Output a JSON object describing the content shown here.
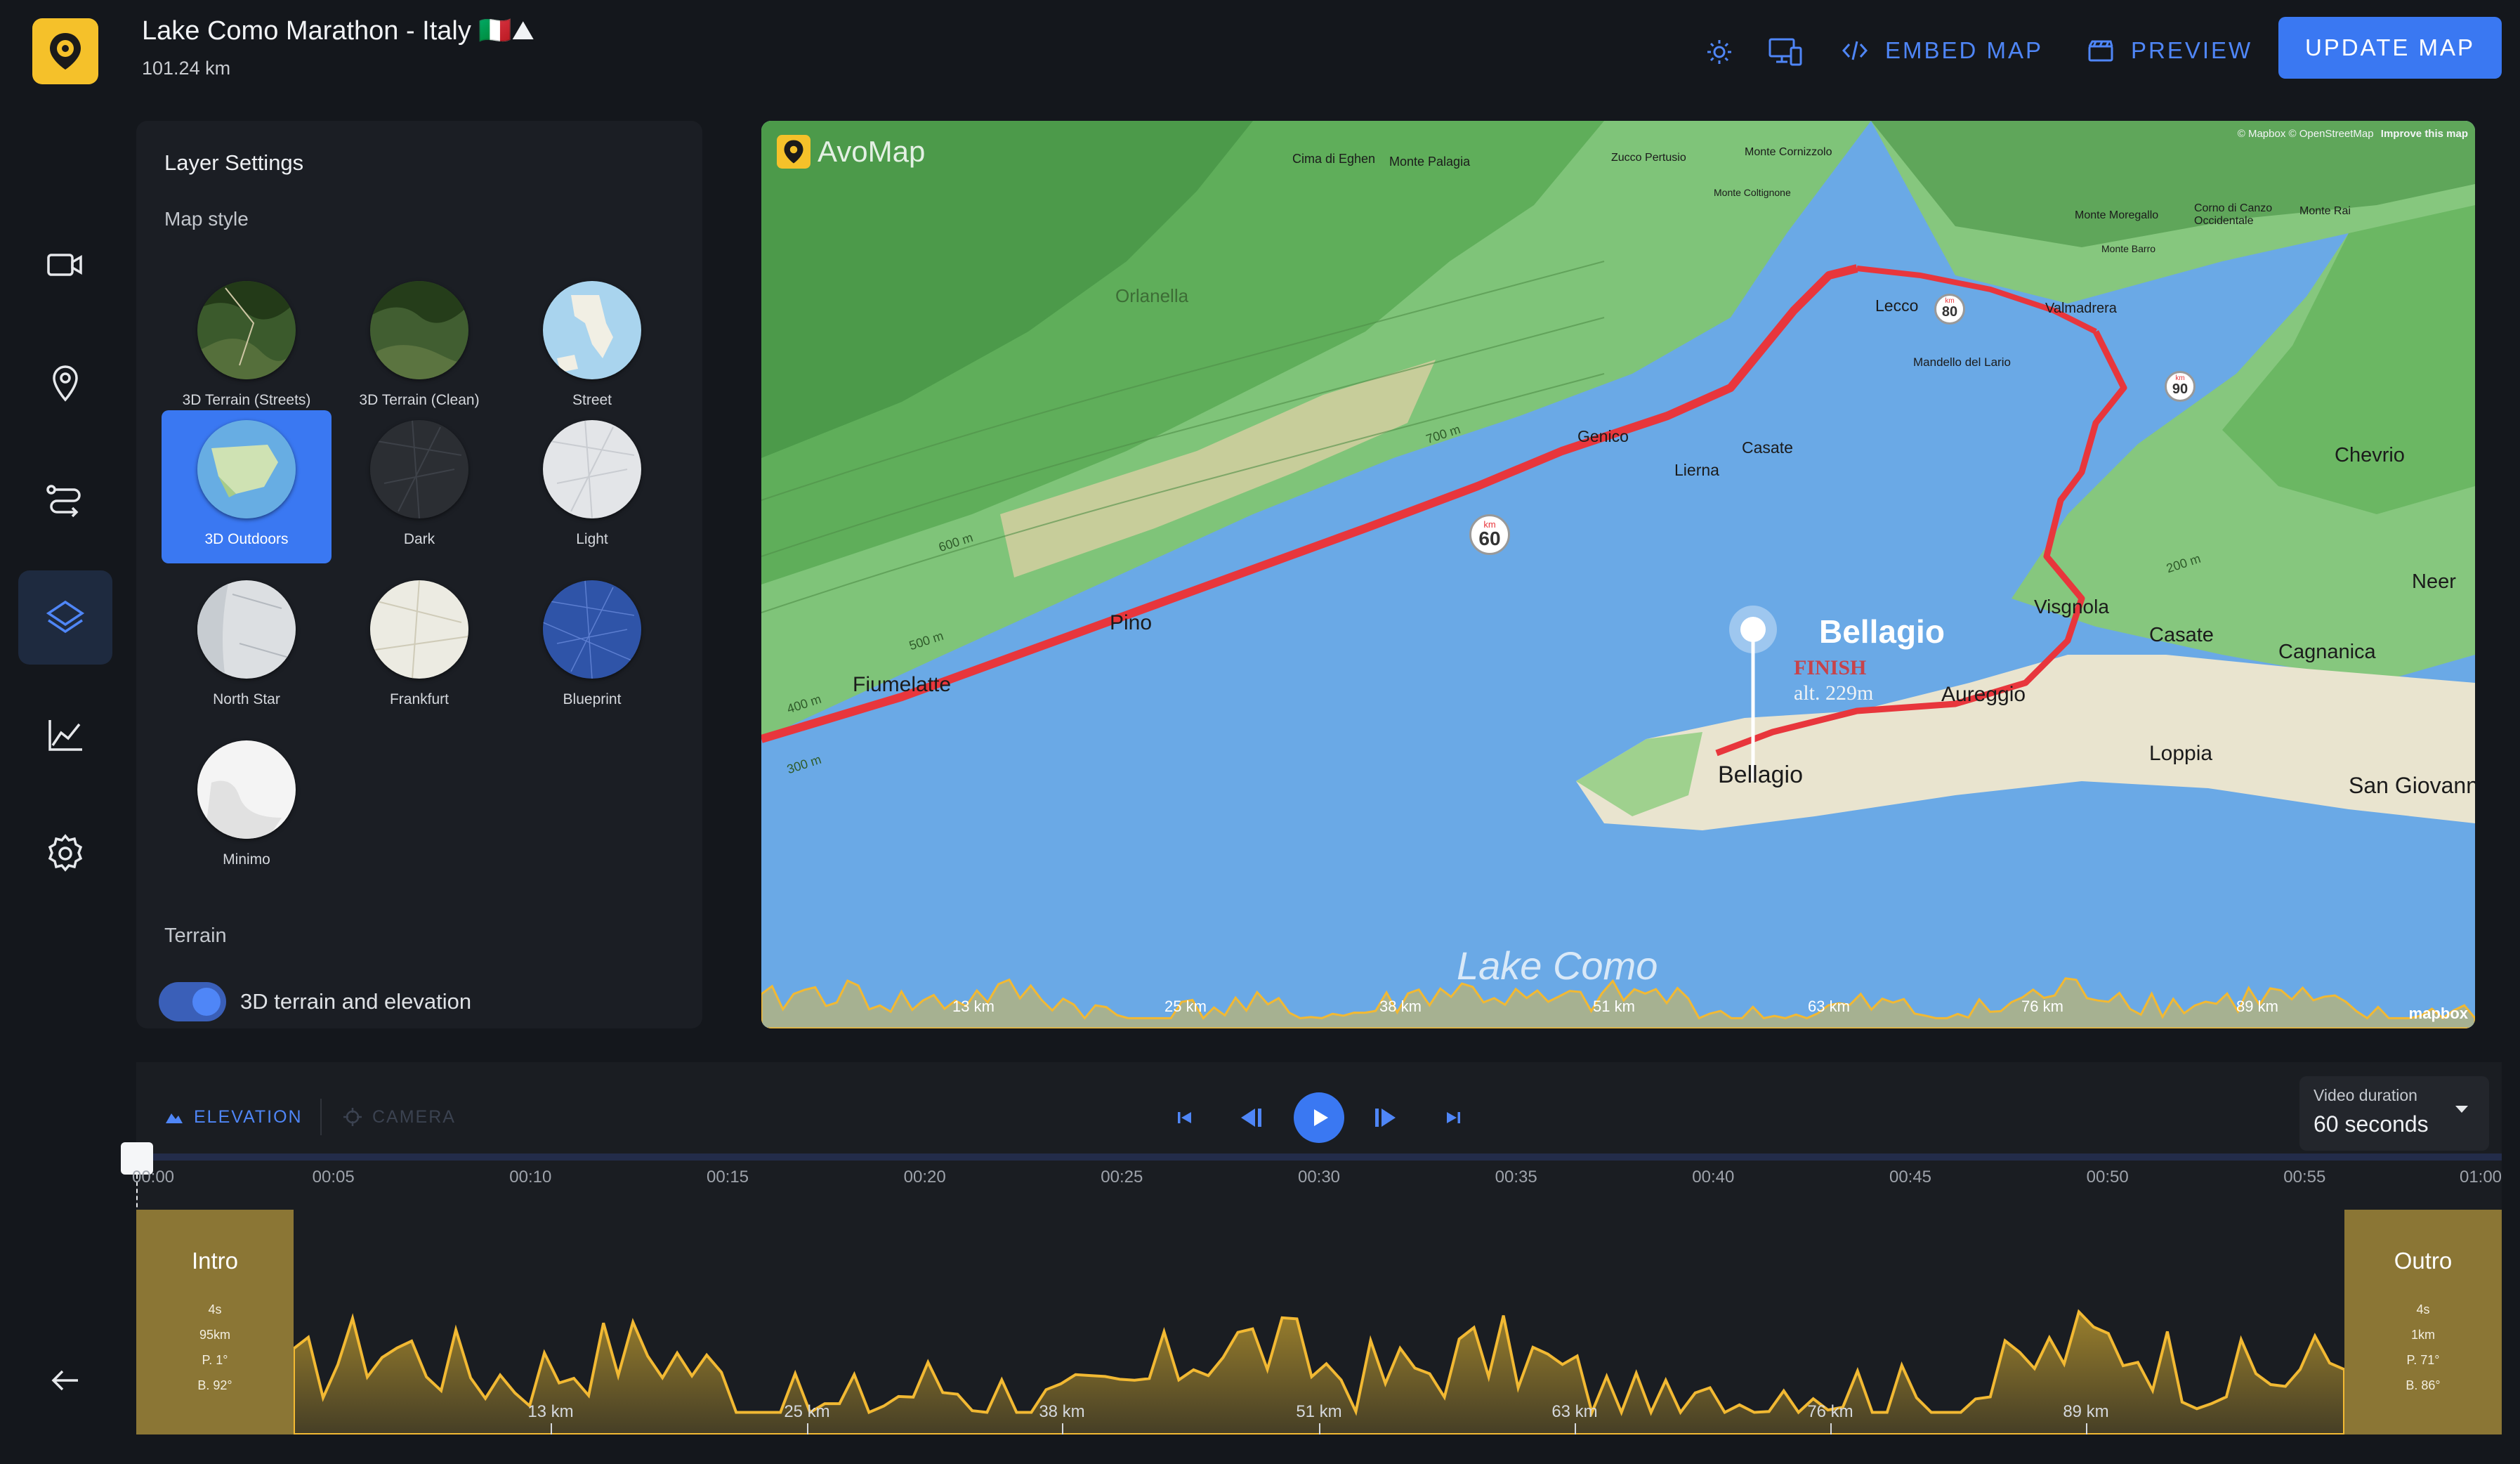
{
  "header": {
    "title": "Lake Como Marathon - Italy 🇮🇹⛰",
    "distance": "101.24 km",
    "embed_label": "EMBED MAP",
    "preview_label": "PREVIEW",
    "update_label": "UPDATE MAP"
  },
  "rail": {
    "items": [
      "video-camera-icon",
      "location-pin-icon",
      "route-icon",
      "layers-icon",
      "chart-icon",
      "gear-icon"
    ],
    "active": "layers-icon",
    "back_icon": "arrow-left-icon"
  },
  "panel": {
    "title": "Layer Settings",
    "map_style_label": "Map style",
    "styles": [
      {
        "label": "3D Terrain (Streets)",
        "color": "#3d5a2e"
      },
      {
        "label": "3D Terrain (Clean)",
        "color": "#415e31"
      },
      {
        "label": "Street",
        "color": "#a9d4ee"
      },
      {
        "label": "3D Outdoors",
        "color": "#67ade3"
      },
      {
        "label": "Dark",
        "color": "#2b2e33"
      },
      {
        "label": "Light",
        "color": "#e3e5e8"
      },
      {
        "label": "North Star",
        "color": "#dcdfe2"
      },
      {
        "label": "Frankfurt",
        "color": "#ecebe2"
      },
      {
        "label": "Blueprint",
        "color": "#2f54a8"
      },
      {
        "label": "Minimo",
        "color": "#f4f4f4"
      }
    ],
    "selected_style": "3D Outdoors",
    "terrain_label": "Terrain",
    "terrain_toggle_label": "3D terrain and elevation",
    "terrain_enabled": true
  },
  "map": {
    "brand": "AvoMap",
    "attribution": "© Mapbox © OpenStreetMap",
    "improve_link": "Improve this map",
    "mapbox_logo": "mapbox",
    "lake_label": "Lake Como",
    "finish_town": "Bellagio",
    "finish_label": "FINISH",
    "finish_alt": "alt. 229m",
    "km_markers": [
      {
        "km_label": "km",
        "value": "60"
      },
      {
        "km_label": "km",
        "value": "80"
      },
      {
        "km_label": "km",
        "value": "90"
      }
    ],
    "places": [
      "Fiumelatte",
      "Pino",
      "Genico",
      "Lierna",
      "Casate",
      "Lecco",
      "Valmadrera",
      "Chevrio",
      "Visgnola",
      "Casate",
      "Cagnanica",
      "Neer",
      "Aureggio",
      "Loppia",
      "San Giovann",
      "Bellagio",
      "Orlanella",
      "Cima di Eghen",
      "Monte Palagia",
      "Zucco Pertusio",
      "Monte Cornizzolo",
      "Monte Moregallo",
      "Corno di Canzo Occidentale",
      "Monte Rai",
      "Mandello del Lario",
      "Monte Coltignone",
      "Monte Barro"
    ],
    "contour_labels": [
      "600 m",
      "500 m",
      "400 m",
      "300 m",
      "700 m",
      "200 m"
    ],
    "profile_km_labels": [
      "13 km",
      "25 km",
      "38 km",
      "51 km",
      "63 km",
      "76 km",
      "89 km"
    ]
  },
  "timeline": {
    "tabs": [
      {
        "label": "ELEVATION",
        "active": true
      },
      {
        "label": "CAMERA",
        "active": false
      }
    ],
    "video_duration_label": "Video duration",
    "video_duration_value": "60 seconds",
    "time_ticks": [
      "00:00",
      "00:05",
      "00:10",
      "00:15",
      "00:20",
      "00:25",
      "00:30",
      "00:35",
      "00:40",
      "00:45",
      "00:50",
      "00:55",
      "01:00"
    ],
    "progress": 0,
    "intro": {
      "title": "Intro",
      "duration": "4s",
      "distance": "95km",
      "pitch": "P. 1°",
      "bearing": "B. 92°"
    },
    "outro": {
      "title": "Outro",
      "duration": "4s",
      "distance": "1km",
      "pitch": "P. 71°",
      "bearing": "B. 86°"
    },
    "km_ticks": [
      "13 km",
      "25 km",
      "38 km",
      "51 km",
      "63 km",
      "76 km",
      "89 km"
    ]
  },
  "colors": {
    "accent": "#3a78f2",
    "brand": "#f5c12a",
    "route": "#e8363c",
    "elevation_line": "#f2b933",
    "segment": "#8b7635"
  }
}
